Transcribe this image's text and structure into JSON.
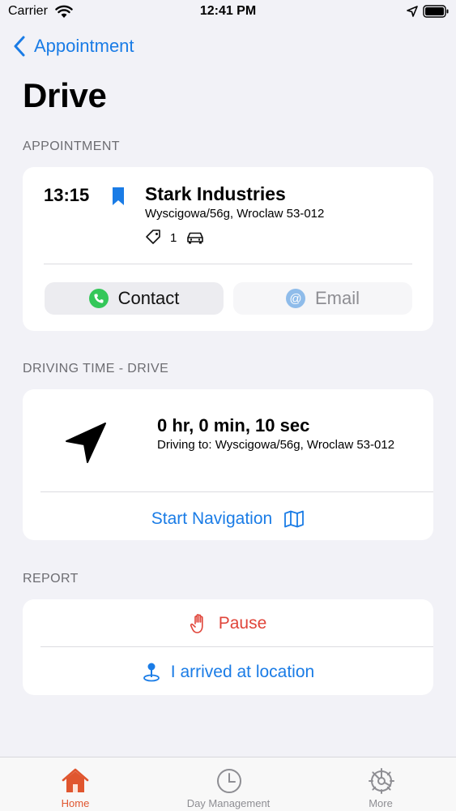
{
  "status_bar": {
    "carrier": "Carrier",
    "time": "12:41 PM"
  },
  "nav": {
    "back_label": "Appointment",
    "title": "Drive"
  },
  "appointment": {
    "section_header": "APPOINTMENT",
    "time": "13:15",
    "company": "Stark Industries",
    "address": "Wyscigowa/56g, Wroclaw 53-012",
    "tag_count": "1",
    "contact_label": "Contact",
    "email_label": "Email"
  },
  "driving": {
    "section_header": "DRIVING TIME - DRIVE",
    "duration": "0 hr, 0 min, 10 sec",
    "driving_to": "Driving to: Wyscigowa/56g, Wroclaw 53-012",
    "start_navigation": "Start Navigation"
  },
  "report": {
    "section_header": "REPORT",
    "pause": "Pause",
    "arrived": "I arrived at location"
  },
  "tabs": [
    {
      "label": "Home",
      "icon": "house-icon"
    },
    {
      "label": "Day Management",
      "icon": "clock-icon"
    },
    {
      "label": "More",
      "icon": "gear-icon"
    }
  ],
  "colors": {
    "accent": "#1a7ce6",
    "destructive": "#e0453a",
    "active_tab": "#e0562f",
    "background": "#f2f2f7"
  }
}
